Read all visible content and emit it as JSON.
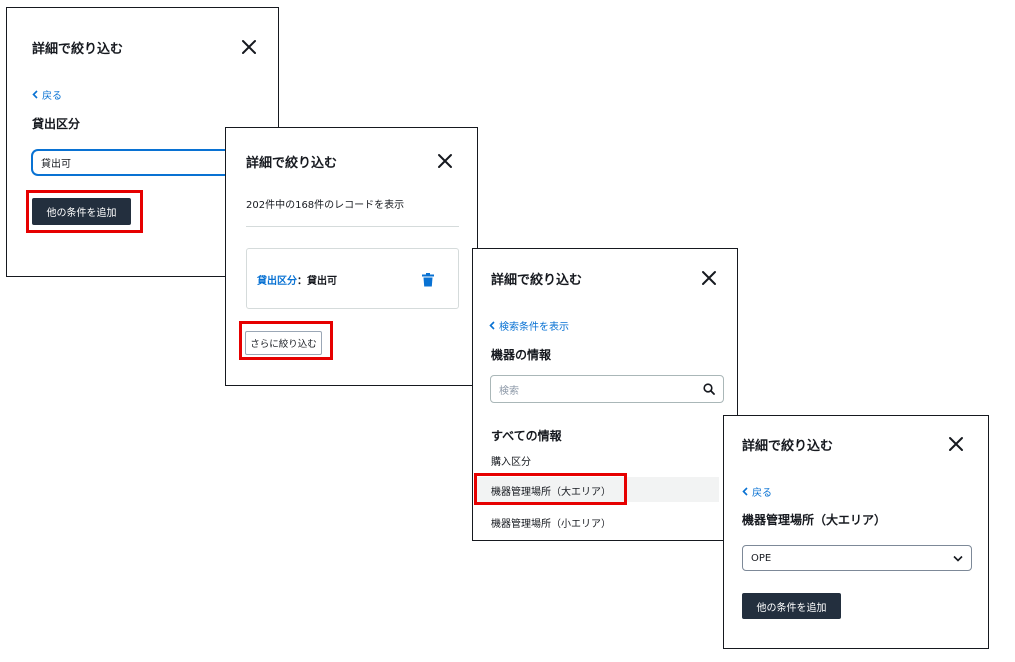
{
  "panel1": {
    "title": "詳細で絞り込む",
    "back_label": "戻る",
    "field_label": "貸出区分",
    "input_value": "貸出可",
    "add_button": "他の条件を追加"
  },
  "panel2": {
    "title": "詳細で絞り込む",
    "record_count": "202件中の168件のレコードを表示",
    "filter_key": "貸出区分",
    "filter_sep": "：",
    "filter_value": "貸出可",
    "refine_button": "さらに絞り込む"
  },
  "panel3": {
    "title": "詳細で絞り込む",
    "back_label": "検索条件を表示",
    "section_label": "機器の情報",
    "search_placeholder": "検索",
    "all_info_label": "すべての情報",
    "items": [
      {
        "label": "購入区分"
      },
      {
        "label": "機器管理場所（大エリア）"
      },
      {
        "label": "機器管理場所（小エリア）"
      }
    ]
  },
  "panel4": {
    "title": "詳細で絞り込む",
    "back_label": "戻る",
    "field_label": "機器管理場所（大エリア）",
    "select_value": "OPE",
    "add_button": "他の条件を追加"
  },
  "colors": {
    "link": "#0972d3",
    "primary_button": "#232f3e",
    "highlight": "#e60000"
  }
}
